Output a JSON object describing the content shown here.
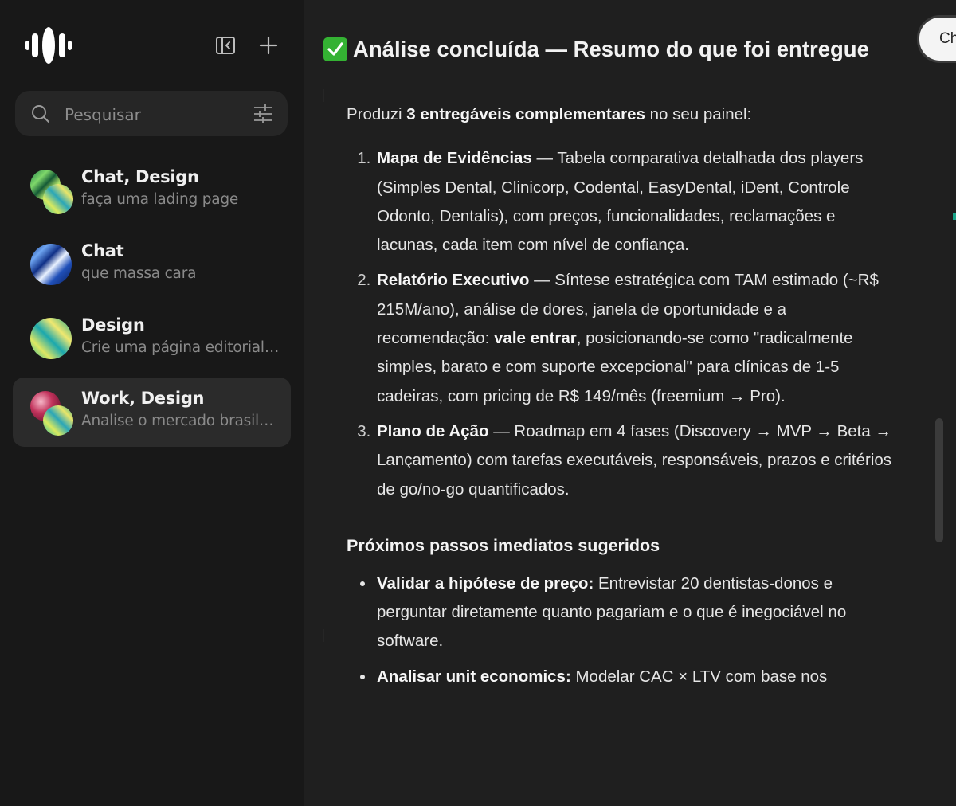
{
  "sidebar": {
    "logo_icon": "soundwave-logo-icon",
    "toggle_sidebar_icon": "sidebar-toggle-icon",
    "new_chat_icon": "plus-icon",
    "search": {
      "placeholder": "Pesquisar",
      "filter_icon": "sliders-icon"
    },
    "chats": [
      {
        "title": "Chat, Design",
        "subtitle": "faça uma lading page",
        "active": false
      },
      {
        "title": "Chat",
        "subtitle": "que massa cara",
        "active": false
      },
      {
        "title": "Design",
        "subtitle": "Crie uma página editorial para um",
        "active": false
      },
      {
        "title": "Work, Design",
        "subtitle": "Analise o mercado brasileiro de software",
        "active": true
      }
    ]
  },
  "main": {
    "heading_emoji": "✅",
    "heading": "Análise concluída — Resumo do que foi entregue",
    "top_pill_label": "Ch",
    "intro_prefix": "Produzi ",
    "intro_bold": "3 entregáveis complementares",
    "intro_suffix": " no seu painel:",
    "deliverables": [
      {
        "title": "Mapa de Evidências",
        "text": " — Tabela comparativa detalhada dos players (Simples Dental, Clinicorp, Codental, EasyDental, iDent, Controle Odonto, Dentalis), com preços, funcionalidades, reclamações e lacunas, cada item com nível de confiança."
      },
      {
        "title": "Relatório Executivo",
        "text_before": " — Síntese estratégica com TAM estimado (~R$ 215M/ano), análise de dores, janela de oportunidade e a recomendação: ",
        "text_bold": "vale entrar",
        "text_after": ", posicionando-se como \"radicalmente simples, barato e com suporte excepcional\" para clínicas de 1-5 cadeiras, com pricing de R$ 149/mês (freemium → Pro)."
      },
      {
        "title": "Plano de Ação",
        "text": " — Roadmap em 4 fases (Discovery → MVP → Beta → Lançamento) com tarefas executáveis, responsáveis, prazos e critérios de go/no-go quantificados."
      }
    ],
    "next_steps_heading": "Próximos passos imediatos sugeridos",
    "next_steps": [
      {
        "title": "Validar a hipótese de preço:",
        "text": " Entrevistar 20 dentistas-donos e perguntar diretamente quanto pagariam e o que é inegociável no software."
      },
      {
        "title": "Analisar unit economics:",
        "text": " Modelar CAC × LTV com base nos"
      }
    ]
  }
}
